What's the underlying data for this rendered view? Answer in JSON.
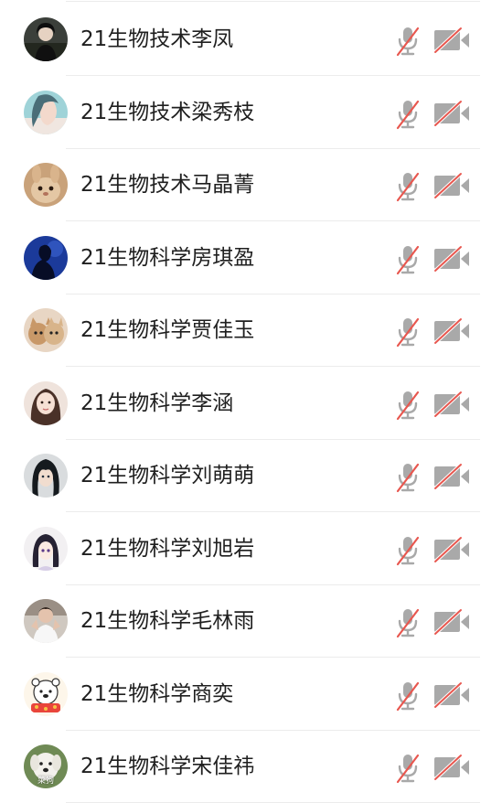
{
  "participants": [
    {
      "name": "21生物技术李凤",
      "avatar": "woman-portrait-dark",
      "mic": "muted",
      "camera": "off"
    },
    {
      "name": "21生物技术梁秀枝",
      "avatar": "woman-profile-teal",
      "mic": "muted",
      "camera": "off"
    },
    {
      "name": "21生物技术马晶菁",
      "avatar": "rabbit-photo",
      "mic": "muted",
      "camera": "off"
    },
    {
      "name": "21生物科学房琪盈",
      "avatar": "silhouette-blue-night",
      "mic": "muted",
      "camera": "off"
    },
    {
      "name": "21生物科学贾佳玉",
      "avatar": "cats-photo",
      "mic": "muted",
      "camera": "off"
    },
    {
      "name": "21生物科学李涵",
      "avatar": "girl-selfie",
      "mic": "muted",
      "camera": "off"
    },
    {
      "name": "21生物科学刘萌萌",
      "avatar": "anime-character-dark-hair",
      "mic": "muted",
      "camera": "off"
    },
    {
      "name": "21生物科学刘旭岩",
      "avatar": "anime-girl-drawing",
      "mic": "muted",
      "camera": "off"
    },
    {
      "name": "21生物科学毛林雨",
      "avatar": "person-photo-white-shirt",
      "mic": "muted",
      "camera": "off"
    },
    {
      "name": "21生物科学商奕",
      "avatar": "cartoon-bear-sticker",
      "mic": "muted",
      "camera": "off"
    },
    {
      "name": "21生物科学宋佳祎",
      "avatar": "dog-photo",
      "avatar_label": "菜狗",
      "mic": "muted",
      "camera": "off"
    }
  ],
  "colors": {
    "icon_gray": "#a9a9a9",
    "slash_red": "#e8574f",
    "name_text": "#1f1f1f",
    "divider": "#ececec"
  }
}
